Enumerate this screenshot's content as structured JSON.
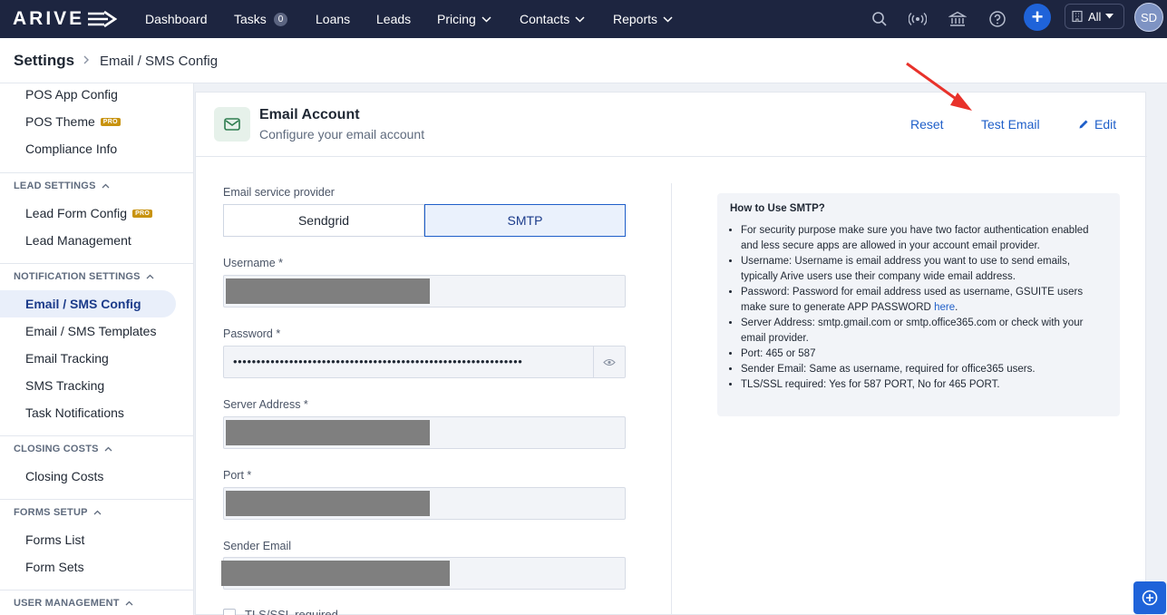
{
  "app": {
    "logo_text": "ARIVE"
  },
  "nav": {
    "items": [
      "Dashboard",
      "Tasks",
      "Loans",
      "Leads",
      "Pricing",
      "Contacts",
      "Reports"
    ],
    "tasks_count": "0",
    "scope_select": "All",
    "user_initials": "SD"
  },
  "breadcrumb": {
    "root": "Settings",
    "current": "Email / SMS Config"
  },
  "sidebar": {
    "top_items": [
      "POS App Config",
      "POS Theme",
      "Compliance Info"
    ],
    "pro_badge": "PRO",
    "sections": [
      {
        "title": "LEAD SETTINGS",
        "items": [
          "Lead Form Config",
          "Lead Management"
        ]
      },
      {
        "title": "NOTIFICATION SETTINGS",
        "items": [
          "Email / SMS Config",
          "Email / SMS Templates",
          "Email Tracking",
          "SMS Tracking",
          "Task Notifications"
        ]
      },
      {
        "title": "CLOSING COSTS",
        "items": [
          "Closing Costs"
        ]
      },
      {
        "title": "FORMS SETUP",
        "items": [
          "Forms List",
          "Form Sets"
        ]
      },
      {
        "title": "USER MANAGEMENT",
        "items": []
      }
    ],
    "active_item": "Email / SMS Config"
  },
  "card": {
    "title": "Email Account",
    "subtitle": "Configure your email account",
    "actions": {
      "reset": "Reset",
      "test_email": "Test Email",
      "edit": "Edit"
    }
  },
  "form": {
    "provider_label": "Email service provider",
    "providers": [
      "Sendgrid",
      "SMTP"
    ],
    "selected_provider": "SMTP",
    "username_label": "Username *",
    "password_label": "Password *",
    "password_value": "••••••••••••••••••••••••••••••••••••••••••••••••••••••••••••••",
    "server_label": "Server Address *",
    "port_label": "Port *",
    "sender_label": "Sender Email",
    "tls_label": "TLS/SSL required"
  },
  "help": {
    "title": "How to Use SMTP?",
    "items": [
      "For security purpose make sure you have two factor authentication enabled and less secure apps are allowed in your account email provider.",
      "Username: Username is email address you want to use to send emails, typically Arive users use their company wide email address.",
      "Password: Password for email address used as username, GSUITE users make sure to generate APP PASSWORD",
      "Server Address: smtp.gmail.com or smtp.office365.com or check with your email provider.",
      "Port: 465 or 587",
      "Sender Email: Same as username, required for office365 users.",
      "TLS/SSL required: Yes for 587 PORT, No for 465 PORT."
    ],
    "link_text": "here"
  },
  "colors": {
    "nav_bg": "#1d2540",
    "accent": "#1f5fc9",
    "annotation_arrow": "#e8322b",
    "pro_badge": "#c89310"
  }
}
